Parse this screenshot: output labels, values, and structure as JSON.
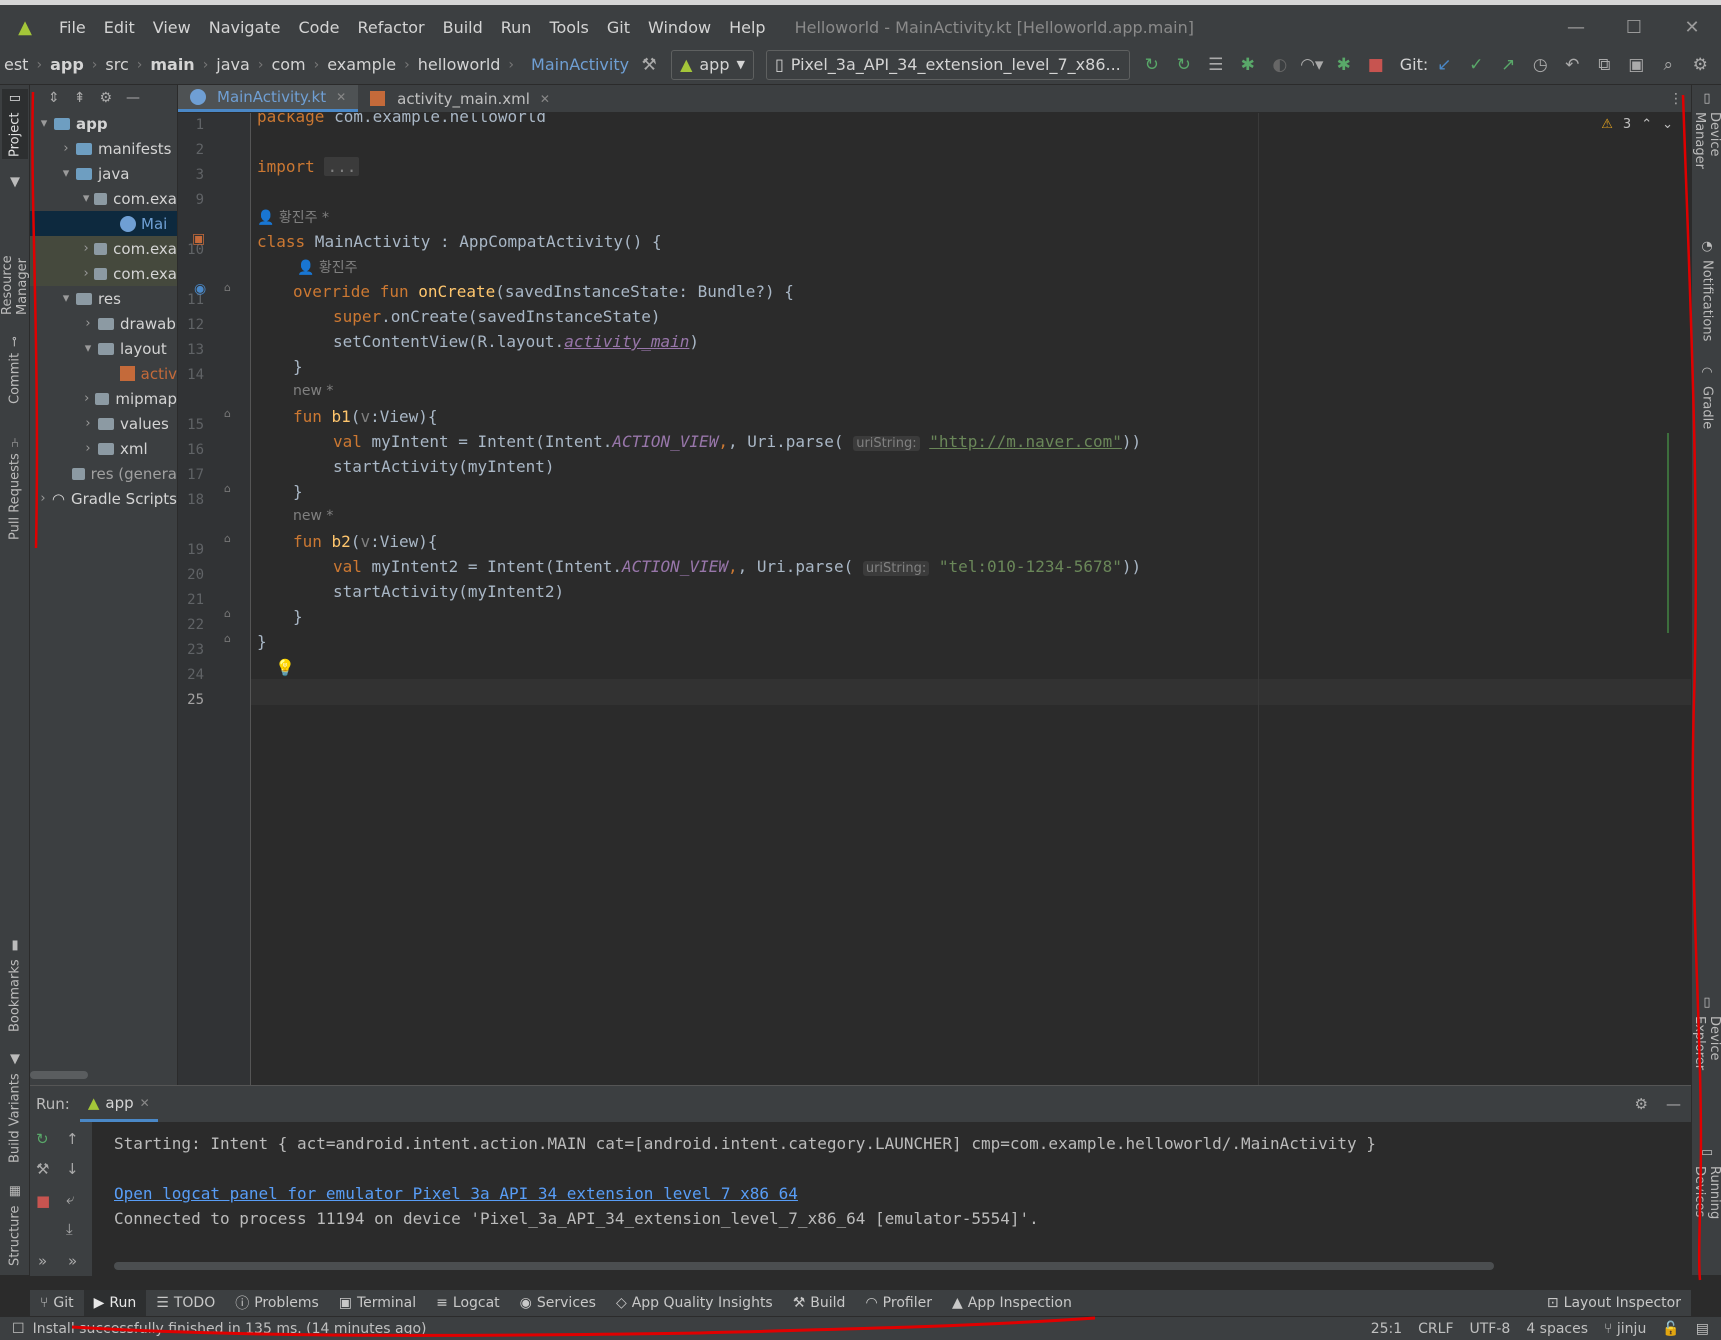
{
  "menubar": {
    "items": [
      "File",
      "Edit",
      "View",
      "Navigate",
      "Code",
      "Refactor",
      "Build",
      "Run",
      "Tools",
      "Git",
      "Window",
      "Help"
    ],
    "window_title": "Helloworld - MainActivity.kt [Helloworld.app.main]"
  },
  "breadcrumbs": [
    "est",
    "app",
    "src",
    "main",
    "java",
    "com",
    "example",
    "helloworld",
    "MainActivity"
  ],
  "toolbar": {
    "run_config": "app",
    "device": "Pixel_3a_API_34_extension_level_7_x86...",
    "git_label": "Git:"
  },
  "left_tabs": [
    "Project",
    "Resource Manager",
    "Commit",
    "Pull Requests",
    "Bookmarks",
    "Build Variants",
    "Structure"
  ],
  "right_tabs": [
    "Device Manager",
    "Notifications",
    "Gradle",
    "Device Explorer",
    "Running Devices"
  ],
  "project_tree": [
    {
      "label": "app",
      "indent": 0,
      "arrow": "▾",
      "icon": "folder-blue"
    },
    {
      "label": "manifests",
      "indent": 1,
      "arrow": "›",
      "icon": "folder-blue"
    },
    {
      "label": "java",
      "indent": 1,
      "arrow": "▾",
      "icon": "folder-blue"
    },
    {
      "label": "com.exa",
      "indent": 2,
      "arrow": "▾",
      "icon": "folder"
    },
    {
      "label": "Mai",
      "indent": 3,
      "arrow": "",
      "icon": "kt"
    },
    {
      "label": "com.exa",
      "indent": 2,
      "arrow": "›",
      "icon": "folder"
    },
    {
      "label": "com.exa",
      "indent": 2,
      "arrow": "›",
      "icon": "folder"
    },
    {
      "label": "res",
      "indent": 1,
      "arrow": "▾",
      "icon": "folder"
    },
    {
      "label": "drawab",
      "indent": 2,
      "arrow": "›",
      "icon": "folder"
    },
    {
      "label": "layout",
      "indent": 2,
      "arrow": "▾",
      "icon": "folder"
    },
    {
      "label": "activ",
      "indent": 3,
      "arrow": "",
      "icon": "xml"
    },
    {
      "label": "mipmap",
      "indent": 2,
      "arrow": "›",
      "icon": "folder"
    },
    {
      "label": "values",
      "indent": 2,
      "arrow": "›",
      "icon": "folder"
    },
    {
      "label": "xml",
      "indent": 2,
      "arrow": "›",
      "icon": "folder"
    },
    {
      "label": "res (genera",
      "indent": 1,
      "arrow": "",
      "icon": "folder"
    },
    {
      "label": "Gradle Scripts",
      "indent": 0,
      "arrow": "›",
      "icon": "gradle"
    }
  ],
  "editor_tabs": [
    "MainActivity.kt",
    "activity_main.xml"
  ],
  "inspections": {
    "warning_count": "3"
  },
  "code": {
    "line_numbers": [
      "1",
      "2",
      "3",
      "9",
      "",
      "10",
      "",
      "11",
      "12",
      "13",
      "14",
      "",
      "15",
      "16",
      "17",
      "18",
      "",
      "19",
      "20",
      "21",
      "22",
      "23",
      "24",
      "25"
    ],
    "author": "황진주",
    "author_star": "황진주 *",
    "new_hint": "new *",
    "l1_kw": "package",
    "l1_rest": " com.example.helloworld",
    "l3_kw": "import",
    "l3_fold": "...",
    "l10_kw": "class",
    "l10_rest": " MainActivity : AppCompatActivity() {",
    "l11_kw": "override fun ",
    "l11_fn": "onCreate",
    "l11_rest": "(savedInstanceState: Bundle?) {",
    "l12_kw": "super",
    "l12_rest": ".onCreate(savedInstanceState)",
    "l13_pre": "setContentView(R.layout.",
    "l13_res": "activity_main",
    "l13_post": ")",
    "l14": "}",
    "l15_kw": "fun ",
    "l15_fn": "b1",
    "l15_p1": "(",
    "l15_param": "v",
    "l15_rest": ":View){",
    "l16_kw": "val",
    "l16_a": " myIntent = Intent(Intent.",
    "l16_const": "ACTION_VIEW",
    "l16_b": ", Uri.parse(",
    "l16_inlay": "uriString:",
    "l16_str": "\"http://m.naver.com\"",
    "l16_c": "))",
    "l17": "startActivity(myIntent)",
    "l18": "}",
    "l19_kw": "fun ",
    "l19_fn": "b2",
    "l19_p1": "(",
    "l19_param": "v",
    "l19_rest": ":View){",
    "l20_kw": "val",
    "l20_a": " myIntent2 = Intent(Intent.",
    "l20_const": "ACTION_VIEW",
    "l20_b": ", Uri.parse(",
    "l20_inlay": "uriString:",
    "l20_str": "\"tel:010-1234-5678\"",
    "l20_c": "))",
    "l21": "startActivity(myIntent2)",
    "l22": "}",
    "l23": "}"
  },
  "run_panel": {
    "label": "Run:",
    "tab": "app",
    "lines": [
      "Starting: Intent { act=android.intent.action.MAIN cat=[android.intent.category.LAUNCHER] cmp=com.example.helloworld/.MainActivity }",
      "Open logcat panel for emulator Pixel 3a API 34 extension level 7 x86 64",
      "Connected to process 11194 on device 'Pixel_3a_API_34_extension_level_7_x86_64 [emulator-5554]'."
    ]
  },
  "tool_windows": [
    "Git",
    "Run",
    "TODO",
    "Problems",
    "Terminal",
    "Logcat",
    "Services",
    "App Quality Insights",
    "Build",
    "Profiler",
    "App Inspection"
  ],
  "layout_inspector": "Layout Inspector",
  "status": {
    "message": "Install successfully finished in 135 ms. (14 minutes ago)",
    "position": "25:1",
    "line_sep": "CRLF",
    "encoding": "UTF-8",
    "indent": "4 spaces",
    "branch": "jinju"
  },
  "colors": {
    "accent": "#4a88c7",
    "keyword": "#cc7832",
    "function": "#ffc66d",
    "string": "#6a8759",
    "annotation": "#e00000"
  }
}
